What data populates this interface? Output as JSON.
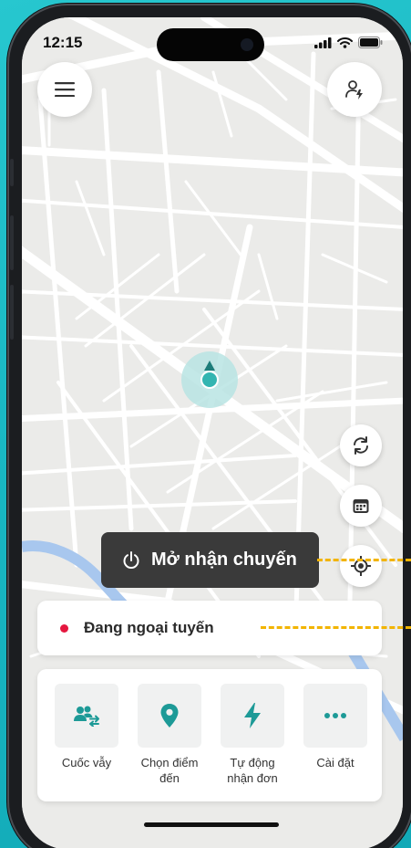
{
  "status_bar": {
    "time": "12:15"
  },
  "toggle_button": {
    "label": "Mở nhận chuyến"
  },
  "status_card": {
    "label": "Đang ngoại tuyến",
    "dot_color": "#e5173f"
  },
  "actions": [
    {
      "label": "Cuốc vẫy",
      "icon": "users-swap-icon"
    },
    {
      "label": "Chọn điểm đến",
      "icon": "map-pin-icon"
    },
    {
      "label": "Tự động nhận đơn",
      "icon": "lightning-icon"
    },
    {
      "label": "Cài đặt",
      "icon": "more-dots-icon"
    }
  ],
  "theme": {
    "accent": "#1d9a97",
    "background": "#20bcc8",
    "annotation": "#f2b400"
  }
}
